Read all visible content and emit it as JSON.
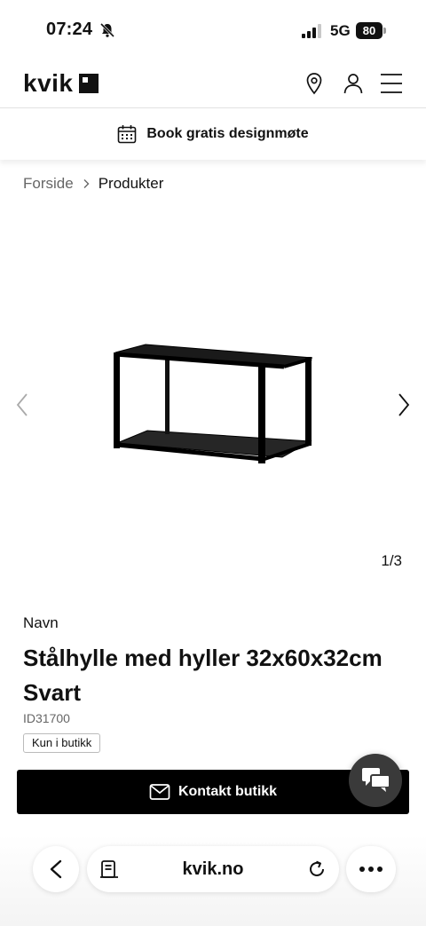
{
  "status_bar": {
    "time": "07:24",
    "network": "5G",
    "battery": "80"
  },
  "header": {
    "logo": "kvik",
    "icons": [
      "location-icon",
      "user-icon",
      "menu-icon"
    ]
  },
  "banner": {
    "label": "Book gratis designmøte",
    "icon": "calendar-icon"
  },
  "breadcrumb": {
    "home": "Forside",
    "current": "Produkter"
  },
  "gallery": {
    "counter": "1/3"
  },
  "product": {
    "label": "Navn",
    "title": "Stålhylle med hyller 32x60x32cm Svart",
    "id": "ID31700",
    "badge": "Kun i butikk"
  },
  "actions": {
    "contact_label": "Kontakt butikk"
  },
  "browser": {
    "url": "kvik.no"
  },
  "colors": {
    "primary": "#000000",
    "chat_fab": "#3a3a3a",
    "muted_text": "#666666"
  }
}
